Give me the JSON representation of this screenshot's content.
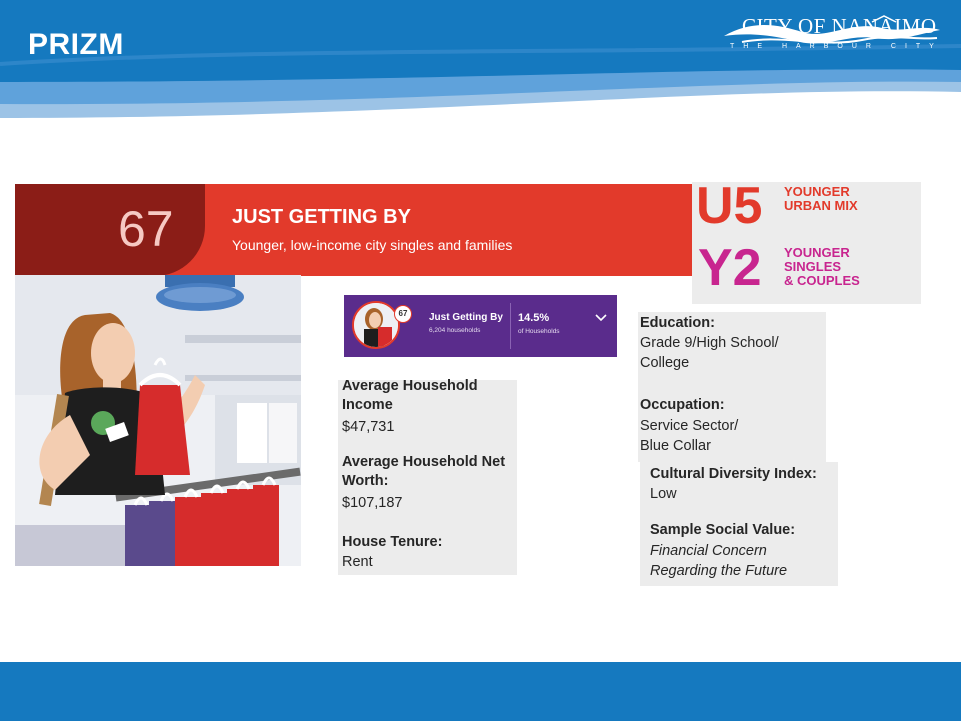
{
  "header": {
    "title": "PRIZM"
  },
  "logo": {
    "name": "CITY OF NANAIMO",
    "tagline": "THE HARBOUR CITY"
  },
  "banner": {
    "number": "67",
    "title": "JUST GETTING BY",
    "subtitle": "Younger, low-income city singles and families"
  },
  "segments": [
    {
      "code": "U5",
      "label_lines": [
        "YOUNGER",
        "URBAN MIX"
      ],
      "color": "#e23a2b"
    },
    {
      "code": "Y2",
      "label_lines": [
        "YOUNGER",
        "SINGLES",
        "& COUPLES"
      ],
      "color": "#c8258f"
    }
  ],
  "widget": {
    "badge": "67",
    "name": "Just Getting By",
    "households": "6,204 households",
    "percent": "14.5%",
    "percent_label": "of Households",
    "chevron_icon": "chevron-down-icon"
  },
  "stats": {
    "income_label": "Average Household Income",
    "income_value": "$47,731",
    "networth_label": "Average Household Net Worth:",
    "networth_value": "$107,187",
    "tenure_label": "House Tenure:",
    "tenure_value": "Rent"
  },
  "profile": {
    "education_label": "Education:",
    "education_value": "Grade 9/High School/ College",
    "occupation_label": "Occupation:",
    "occupation_value": "Service Sector/ Blue Collar",
    "diversity_label": "Cultural Diversity Index:",
    "diversity_value": "Low",
    "social_label": "Sample Social Value:",
    "social_value": "Financial Concern Regarding the Future"
  },
  "colors": {
    "header_blue": "#1579bf",
    "banner_red": "#e23a2b",
    "banner_dark_red": "#8b1d17",
    "magenta": "#c8258f",
    "purple": "#5a2c8c",
    "panel_grey": "#ececec"
  }
}
